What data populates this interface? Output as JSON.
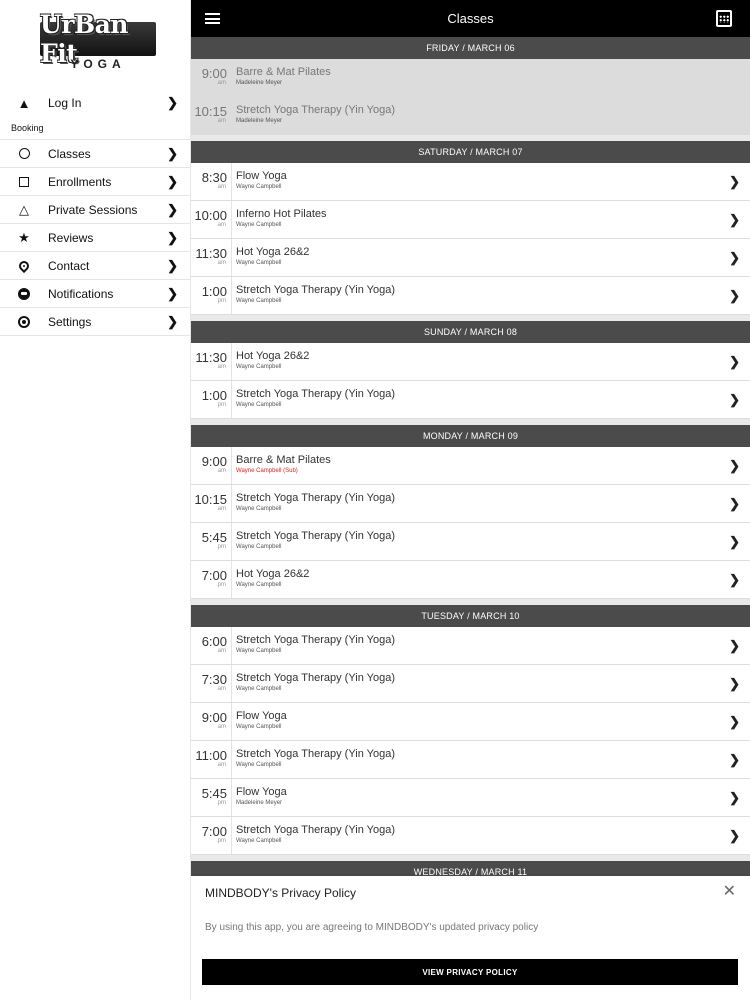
{
  "logo": {
    "main": "UrBan Fit",
    "sub": "YOGA"
  },
  "sidebar": {
    "login": {
      "label": "Log In",
      "icon": "warning-icon"
    },
    "section": "Booking",
    "items": [
      {
        "label": "Classes",
        "icon": "circle-icon"
      },
      {
        "label": "Enrollments",
        "icon": "square-icon"
      },
      {
        "label": "Private Sessions",
        "icon": "triangle-icon"
      },
      {
        "label": "Reviews",
        "icon": "star-icon"
      },
      {
        "label": "Contact",
        "icon": "location-pin-icon"
      },
      {
        "label": "Notifications",
        "icon": "chat-bubble-icon"
      },
      {
        "label": "Settings",
        "icon": "gear-icon"
      }
    ]
  },
  "header": {
    "title": "Classes"
  },
  "days": [
    {
      "label": "FRIDAY / MARCH 06",
      "past": true,
      "classes": [
        {
          "time": "9:00",
          "ampm": "am",
          "name": "Barre & Mat Pilates",
          "instructor": "Madeleine Meyer"
        },
        {
          "time": "10:15",
          "ampm": "am",
          "name": "Stretch Yoga Therapy (Yin Yoga)",
          "instructor": "Madeleine Meyer"
        }
      ]
    },
    {
      "label": "SATURDAY / MARCH 07",
      "classes": [
        {
          "time": "8:30",
          "ampm": "am",
          "name": "Flow Yoga",
          "instructor": "Wayne Campbell"
        },
        {
          "time": "10:00",
          "ampm": "am",
          "name": "Inferno Hot Pilates",
          "instructor": "Wayne Campbell"
        },
        {
          "time": "11:30",
          "ampm": "am",
          "name": "Hot Yoga 26&2",
          "instructor": "Wayne Campbell"
        },
        {
          "time": "1:00",
          "ampm": "pm",
          "name": "Stretch Yoga Therapy (Yin Yoga)",
          "instructor": "Wayne Campbell"
        }
      ]
    },
    {
      "label": "SUNDAY / MARCH 08",
      "classes": [
        {
          "time": "11:30",
          "ampm": "am",
          "name": "Hot Yoga 26&2",
          "instructor": "Wayne Campbell"
        },
        {
          "time": "1:00",
          "ampm": "pm",
          "name": "Stretch Yoga Therapy (Yin Yoga)",
          "instructor": "Wayne Campbell"
        }
      ]
    },
    {
      "label": "MONDAY / MARCH 09",
      "classes": [
        {
          "time": "9:00",
          "ampm": "am",
          "name": "Barre & Mat Pilates",
          "instructor": "Wayne Campbell (Sub)",
          "sub": true
        },
        {
          "time": "10:15",
          "ampm": "am",
          "name": "Stretch Yoga Therapy (Yin Yoga)",
          "instructor": "Wayne Campbell"
        },
        {
          "time": "5:45",
          "ampm": "pm",
          "name": "Stretch Yoga Therapy (Yin Yoga)",
          "instructor": "Wayne Campbell"
        },
        {
          "time": "7:00",
          "ampm": "pm",
          "name": "Hot Yoga 26&2",
          "instructor": "Wayne Campbell"
        }
      ]
    },
    {
      "label": "TUESDAY / MARCH 10",
      "classes": [
        {
          "time": "6:00",
          "ampm": "am",
          "name": "Stretch Yoga Therapy (Yin Yoga)",
          "instructor": "Wayne Campbell"
        },
        {
          "time": "7:30",
          "ampm": "am",
          "name": "Stretch Yoga Therapy (Yin Yoga)",
          "instructor": "Wayne Campbell"
        },
        {
          "time": "9:00",
          "ampm": "am",
          "name": "Flow Yoga",
          "instructor": "Wayne Campbell"
        },
        {
          "time": "11:00",
          "ampm": "am",
          "name": "Stretch Yoga Therapy (Yin Yoga)",
          "instructor": "Wayne Campbell"
        },
        {
          "time": "5:45",
          "ampm": "pm",
          "name": "Flow Yoga",
          "instructor": "Madeleine Meyer"
        },
        {
          "time": "7:00",
          "ampm": "pm",
          "name": "Stretch Yoga Therapy (Yin Yoga)",
          "instructor": "Wayne Campbell"
        }
      ]
    },
    {
      "label": "WEDNESDAY / MARCH 11",
      "classes": []
    }
  ],
  "privacy": {
    "title": "MINDBODY's Privacy Policy",
    "body": "By using this app, you are agreeing to MINDBODY's updated privacy policy",
    "button": "VIEW PRIVACY POLICY"
  },
  "colors": {
    "topbar": "#000000",
    "day_header": "#4b4b4b",
    "sub_instructor": "#e02020"
  }
}
